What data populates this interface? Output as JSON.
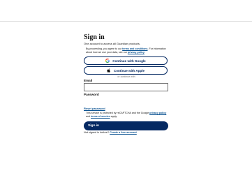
{
  "form": {
    "title": "Sign in",
    "subtitle": "One account to access all Guardian products.",
    "notice_prefix": "By proceeding, you agree to our ",
    "terms_link": "terms and conditions",
    "notice_middle": ". For information about how we use your data, see our ",
    "privacy_link": "privacy policy",
    "notice_suffix": ".",
    "google_label": "Continue with Google",
    "apple_label": "Continue with Apple",
    "divider": "or continue with",
    "email_label": "Email",
    "email_value": "",
    "password_label": "Password",
    "reset_link": "Reset password",
    "recaptcha_prefix": "This service is protected by reCAPTCHA and the Google ",
    "recaptcha_privacy": "privacy policy",
    "recaptcha_and": " and ",
    "recaptcha_terms": "terms of service",
    "recaptcha_suffix": " apply.",
    "signin_label": "Sign in",
    "create_prefix": "Not signed in before? ",
    "create_link": "Create a free account"
  },
  "colors": {
    "brand_navy": "#052962",
    "link_blue": "#0a5291"
  },
  "icons": {
    "google": "google-icon",
    "apple": "apple-icon"
  }
}
